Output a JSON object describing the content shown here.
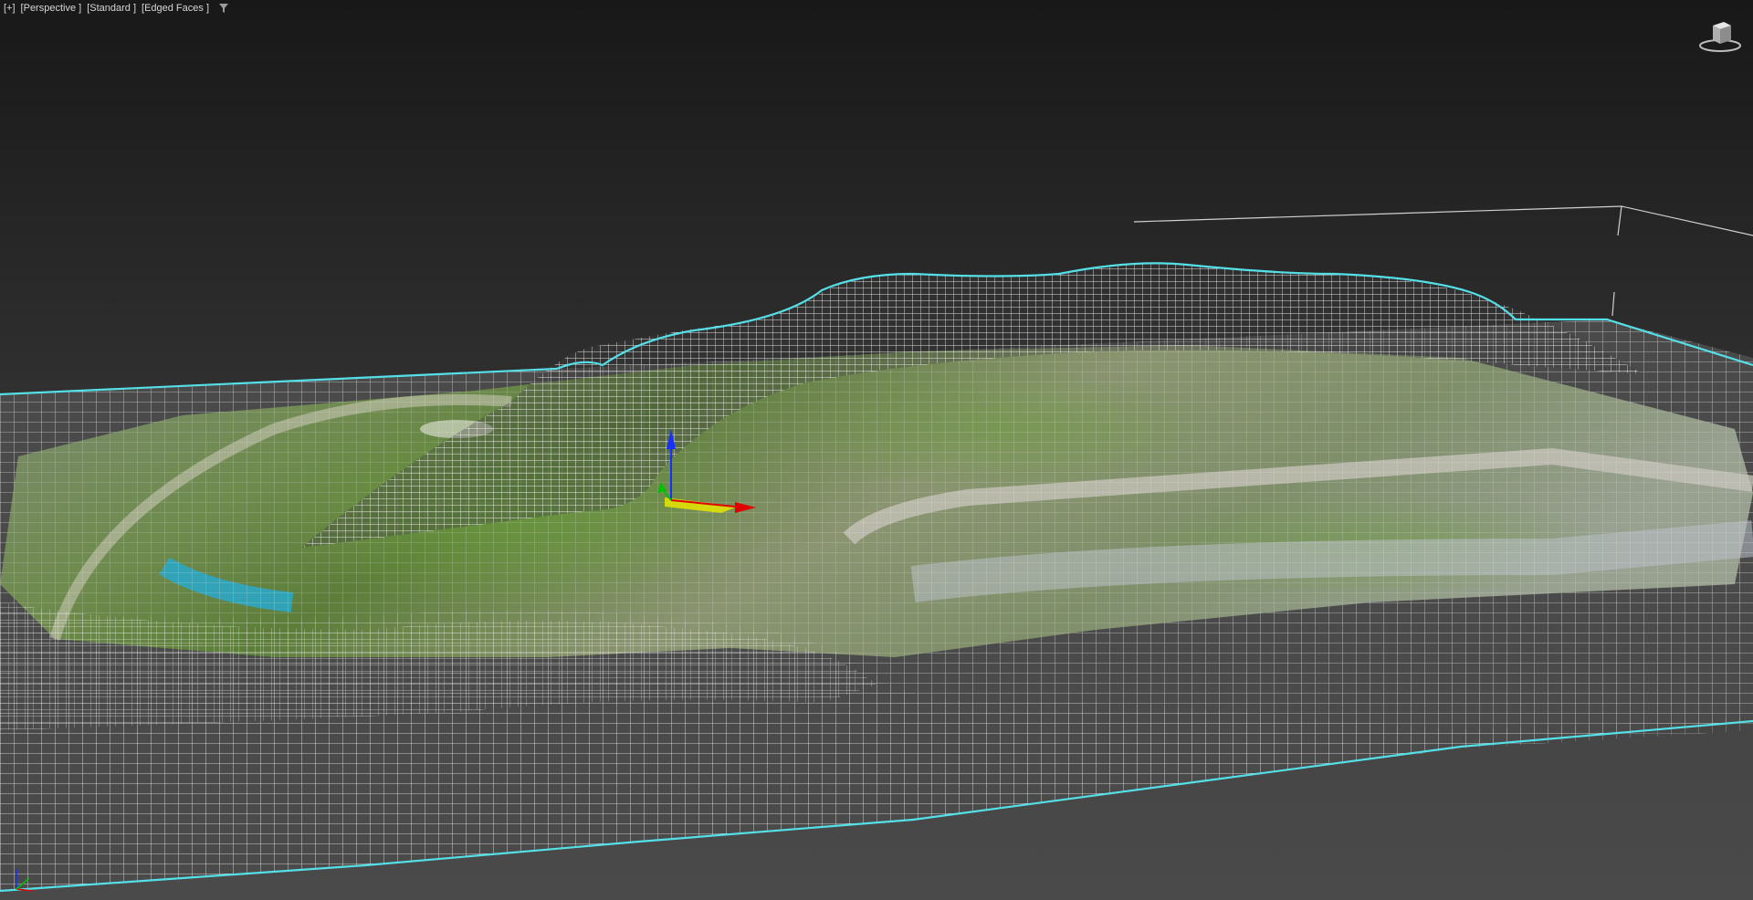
{
  "viewport": {
    "labels": {
      "plus_menu": "[+]",
      "view_menu": "[Perspective ]",
      "shading_menu": "[Standard ]",
      "display_menu": "[Edged Faces ]"
    },
    "icons": {
      "filter": "filter-icon",
      "viewcube": "viewcube-icon",
      "gizmo": "transform-gizmo-icon",
      "axis": "axis-tripod-icon"
    },
    "colors": {
      "background_top": "#181818",
      "background_bottom": "#4a4a4a",
      "selection_outline": "#55e0e8",
      "wireframe": "#ffffff",
      "gizmo_x": "#e00000",
      "gizmo_y": "#00c000",
      "gizmo_z": "#1830ff",
      "gizmo_plane": "#e6e600"
    }
  }
}
